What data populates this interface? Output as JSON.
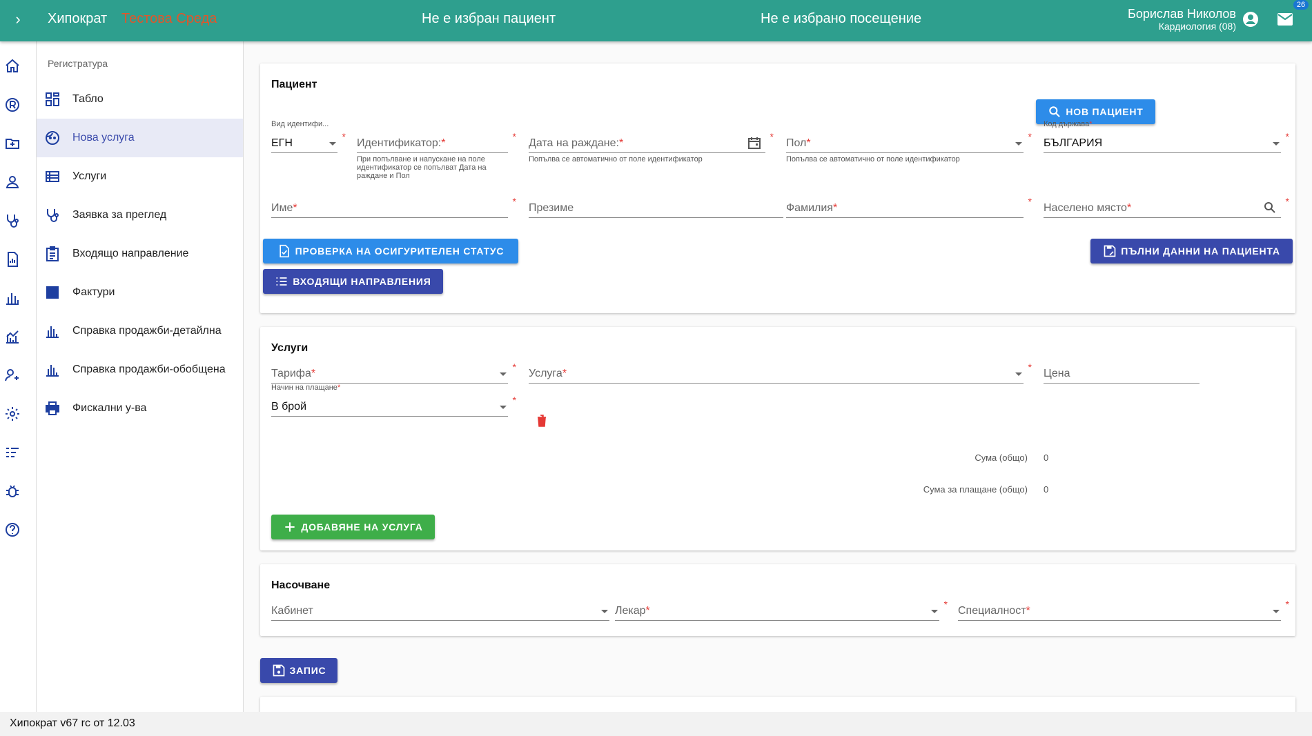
{
  "header": {
    "app_title": "Хипократ",
    "environment": "Тестова Среда",
    "patient_status": "Не е избран пациент",
    "visit_status": "Не е избрано посещение",
    "user_name": "Борислав Николов",
    "user_department": "Кардиология (08)",
    "mail_badge": "26"
  },
  "nav": {
    "section_title": "Регистратура",
    "items": [
      {
        "label": "Табло",
        "icon": "dashboard-icon"
      },
      {
        "label": "Нова услуга",
        "icon": "face-icon",
        "active": true
      },
      {
        "label": "Услуги",
        "icon": "list-icon"
      },
      {
        "label": "Заявка за преглед",
        "icon": "stethoscope-icon"
      },
      {
        "label": "Входящо направление",
        "icon": "clipboard-icon"
      },
      {
        "label": "Фактури",
        "icon": "invoice-icon"
      },
      {
        "label": "Справка продажби-детайлна",
        "icon": "bar-chart-icon"
      },
      {
        "label": "Справка продажби-обобщена",
        "icon": "bar-chart-icon"
      },
      {
        "label": "Фискални у-ва",
        "icon": "printer-icon"
      }
    ]
  },
  "patient_card": {
    "title": "Пациент",
    "new_patient_button": "НОВ ПАЦИЕНТ",
    "id_type_label": "Вид идентифи...",
    "id_type_value": "ЕГН",
    "identifier_placeholder": "Идентификатор:",
    "identifier_hint": "При попълване и напускане на поле идентификатор се попълват Дата на раждане и Пол",
    "birthdate_placeholder": "Дата на раждане:",
    "birthdate_hint": "Попълва се автоматично от поле идентификатор",
    "sex_placeholder": "Пол",
    "sex_hint": "Попълва се автоматично от поле идентификатор",
    "country_label": "Код държава",
    "country_value": "БЪЛГАРИЯ",
    "first_name_placeholder": "Име",
    "middle_name_placeholder": "Презиме",
    "last_name_placeholder": "Фамилия",
    "city_placeholder": "Населено място",
    "insurance_button": "ПРОВЕРКА НА ОСИГУРИТЕЛЕН СТАТУС",
    "full_data_button": "ПЪЛНИ ДАННИ НА ПАЦИЕНТА",
    "referrals_button": "ВХОДЯЩИ НАПРАВЛЕНИЯ"
  },
  "services_card": {
    "title": "Услуги",
    "tariff_placeholder": "Тарифа",
    "service_placeholder": "Услуга",
    "price_placeholder": "Цена",
    "payment_label": "Начин на плащане",
    "payment_value": "В брой",
    "sum_total_label": "Сума (общо)",
    "sum_total_value": "0",
    "sum_pay_label": "Сума за плащане (общо)",
    "sum_pay_value": "0",
    "add_service_button": "ДОБАВЯНЕ НА УСЛУГА"
  },
  "routing_card": {
    "title": "Насочване",
    "cabinet_placeholder": "Кабинет",
    "doctor_placeholder": "Лекар",
    "specialty_placeholder": "Специалност"
  },
  "save_button": "ЗАПИС",
  "footer": "Хипократ v67 rc от 12.03",
  "colors": {
    "header": "#2e9f8e",
    "environment": "#e2552a",
    "primary_blue": "#2d8ce9",
    "indigo": "#3949ab",
    "green": "#3eae49",
    "required": "#e53935"
  }
}
